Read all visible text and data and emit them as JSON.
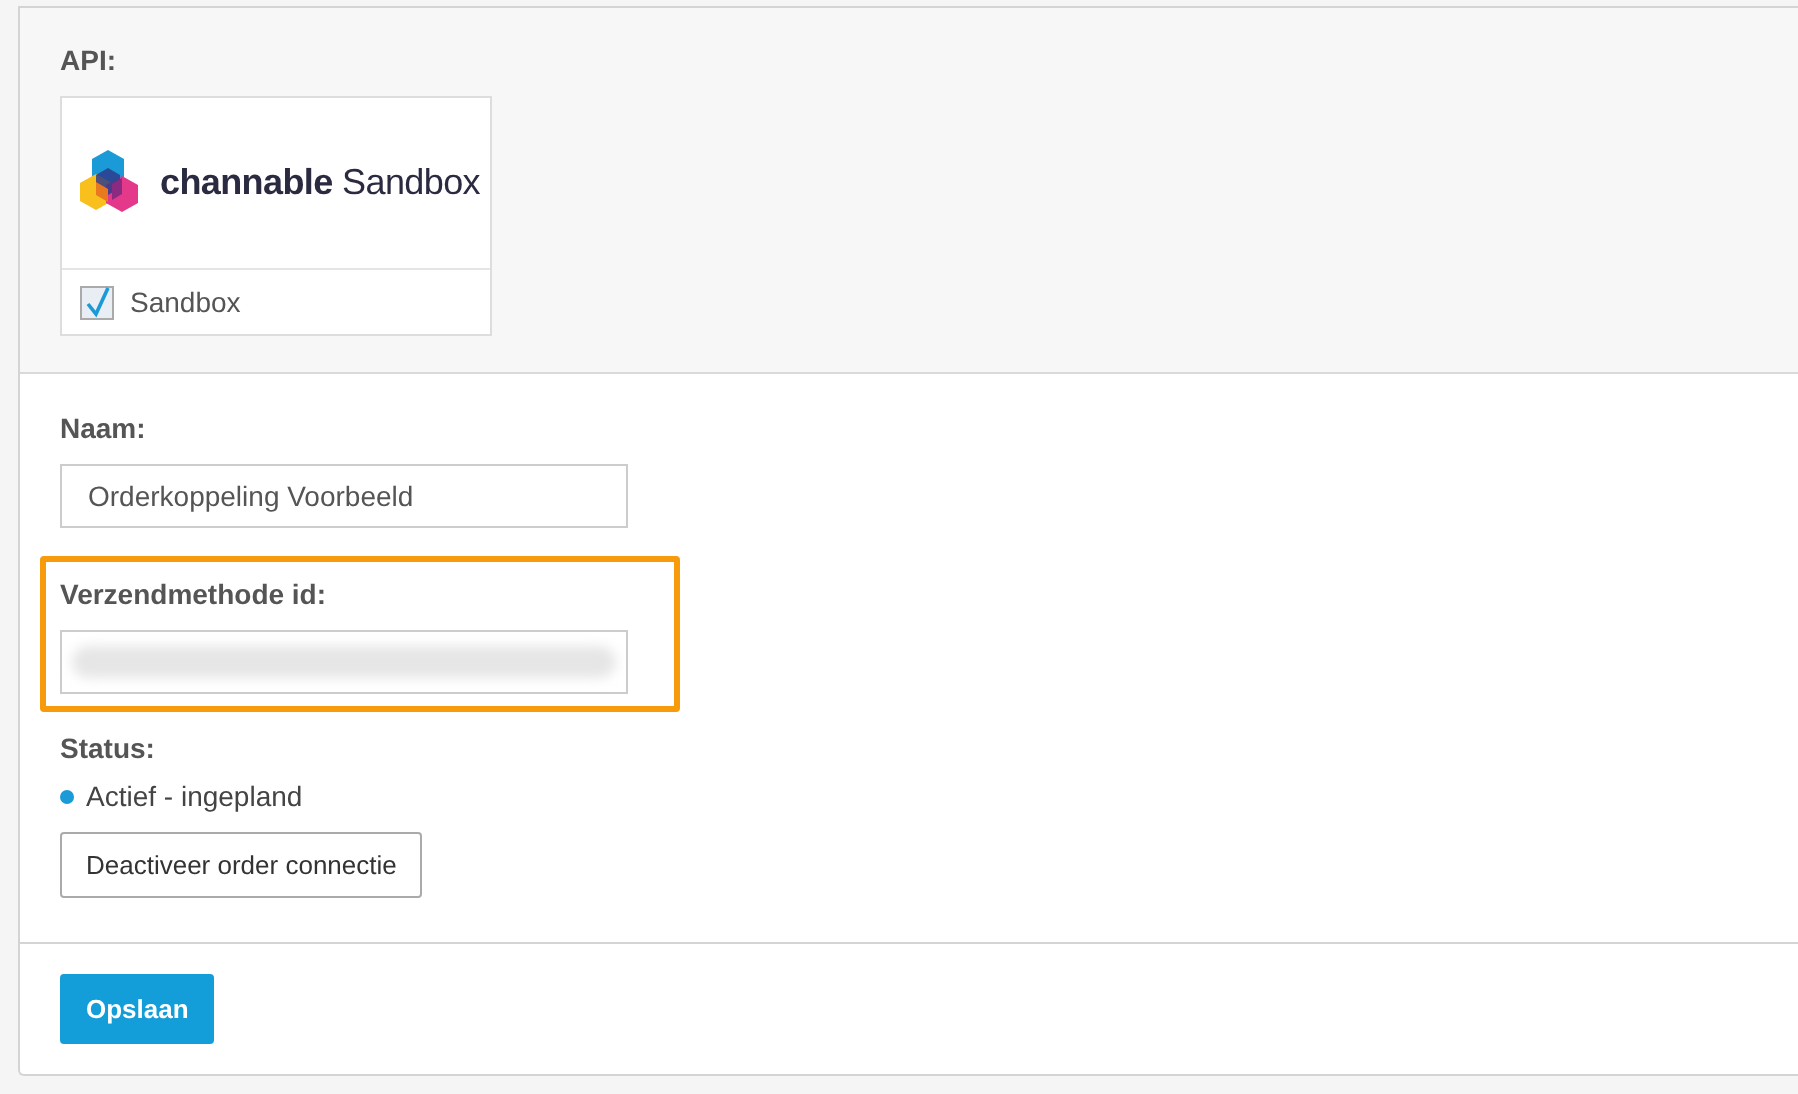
{
  "api": {
    "label": "API:",
    "logo": {
      "brand": "channable",
      "product": "Sandbox"
    },
    "option": {
      "label": "Sandbox",
      "checked": true
    }
  },
  "fields": [
    {
      "label": "Naam:",
      "value": "Orderkoppeling Voorbeeld",
      "highlighted": false,
      "blurred": false
    },
    {
      "label": "Verzendmethode id:",
      "highlighted": true,
      "blurred": true
    }
  ],
  "status": {
    "label": "Status:",
    "text": "Actief - ingepland",
    "color": "#1a9ad6"
  },
  "deactivate_button": "Deactiveer order connectie",
  "save_button": "Opslaan"
}
